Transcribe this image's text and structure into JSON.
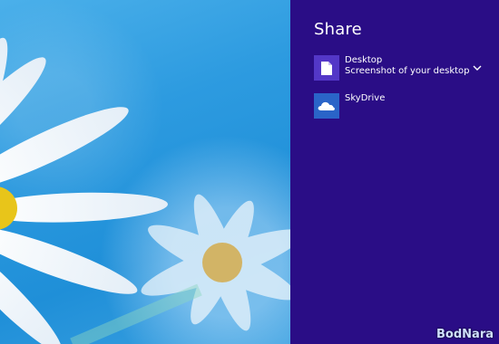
{
  "charm": {
    "title": "Share",
    "items": [
      {
        "name": "Desktop",
        "description": "Screenshot of your desktop",
        "icon": "document-icon"
      },
      {
        "name": "SkyDrive",
        "icon": "cloud-icon"
      }
    ],
    "expand_icon": "chevron-down-icon"
  },
  "watermark": "BodNara",
  "colors": {
    "charm_background": "#2a0d86",
    "desktop_tile": "#5337c7",
    "skydrive_tile": "#2a64c8",
    "wallpaper_sky": "#2d9be0"
  }
}
